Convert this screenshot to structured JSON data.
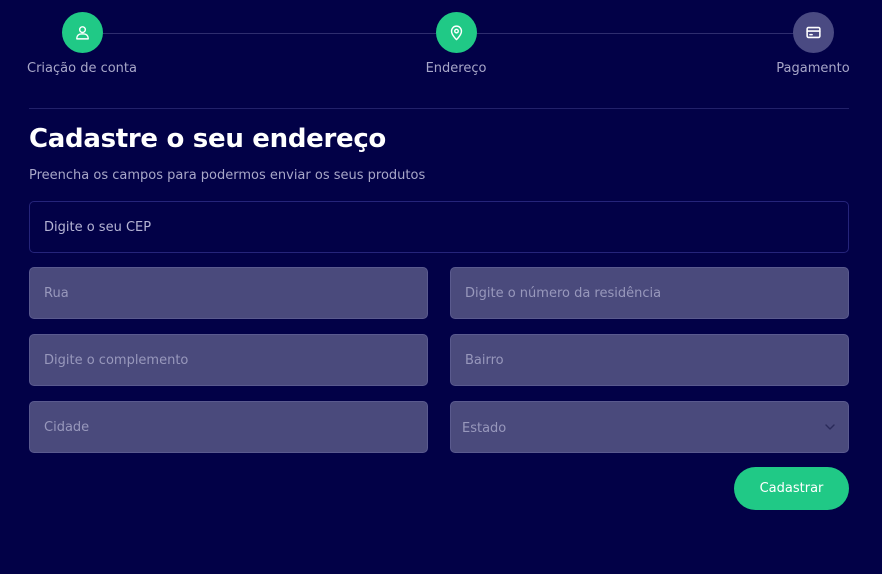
{
  "stepper": {
    "steps": [
      {
        "label": "Criação de conta",
        "icon": "user-icon",
        "status": "done"
      },
      {
        "label": "Endereço",
        "icon": "map-pin-icon",
        "status": "done"
      },
      {
        "label": "Pagamento",
        "icon": "credit-card-icon",
        "status": "pending"
      }
    ]
  },
  "form": {
    "title": "Cadastre o seu endereço",
    "subtitle": "Preencha os campos para podermos enviar os seus produtos",
    "fields": {
      "cep": {
        "placeholder": "Digite o seu CEP",
        "value": ""
      },
      "rua": {
        "placeholder": "Rua",
        "value": ""
      },
      "numero": {
        "placeholder": "Digite o número da residência",
        "value": ""
      },
      "complemento": {
        "placeholder": "Digite o complemento",
        "value": ""
      },
      "bairro": {
        "placeholder": "Bairro",
        "value": ""
      },
      "cidade": {
        "placeholder": "Cidade",
        "value": ""
      },
      "estado": {
        "selected": "Estado",
        "icon": "chevron-down-icon"
      }
    },
    "submit_label": "Cadastrar"
  },
  "colors": {
    "background": "#020147",
    "accent": "#20c986",
    "pending_step": "#4a4a82",
    "input_filled": "#4a4a7c"
  }
}
